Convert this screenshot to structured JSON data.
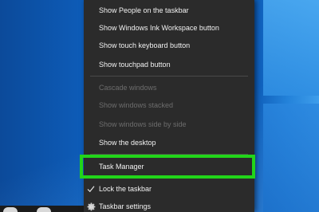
{
  "context_menu": {
    "items": [
      {
        "label": "Show People on the taskbar",
        "enabled": true
      },
      {
        "label": "Show Windows Ink Workspace button",
        "enabled": true
      },
      {
        "label": "Show touch keyboard button",
        "enabled": true
      },
      {
        "label": "Show touchpad button",
        "enabled": true
      },
      {
        "label": "Cascade windows",
        "enabled": false
      },
      {
        "label": "Show windows stacked",
        "enabled": false
      },
      {
        "label": "Show windows side by side",
        "enabled": false
      },
      {
        "label": "Show the desktop",
        "enabled": true
      },
      {
        "label": "Task Manager",
        "enabled": true,
        "highlighted": true
      },
      {
        "label": "Lock the taskbar",
        "enabled": true,
        "checked": true,
        "icon": "checkmark-icon"
      },
      {
        "label": "Taskbar settings",
        "enabled": true,
        "icon": "gear-icon"
      }
    ]
  },
  "colors": {
    "menu_background": "#2b2b2b",
    "highlight_border": "#22d51a",
    "desktop_blue": "#0d5cb8"
  }
}
